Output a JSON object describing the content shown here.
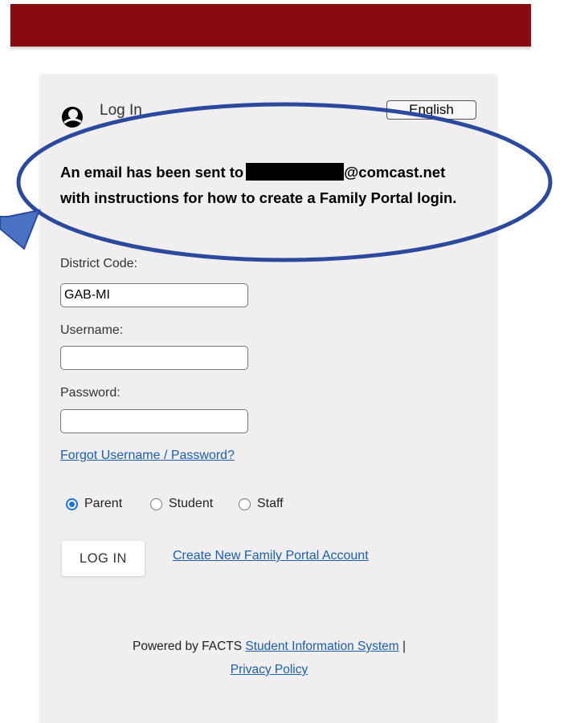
{
  "login": {
    "title": "Log In",
    "language": "English"
  },
  "message": {
    "prefix": "An email has been sent to",
    "email_suffix": "@comcast.net",
    "rest": "with instructions for how to create a Family Portal login."
  },
  "form": {
    "district_label": "District Code:",
    "district_value": "GAB-MI",
    "username_label": "Username:",
    "username_value": "",
    "password_label": "Password:",
    "password_value": "",
    "forgot_link": "Forgot Username / Password?"
  },
  "roles": [
    {
      "label": "Parent",
      "checked": true
    },
    {
      "label": "Student",
      "checked": false
    },
    {
      "label": "Staff",
      "checked": false
    }
  ],
  "actions": {
    "login_button": "LOG IN",
    "create_account_link": "Create New Family Portal Account"
  },
  "footer": {
    "powered_by": "Powered by FACTS",
    "sis_link": "Student Information System",
    "separator": "|",
    "privacy_link": "Privacy Policy"
  },
  "colors": {
    "header": "#8b0a10",
    "card": "#f0eeee",
    "link": "#1a5fb4",
    "annotation": "#2b4a9e"
  },
  "icons": {
    "login": "user-silhouette-icon"
  }
}
